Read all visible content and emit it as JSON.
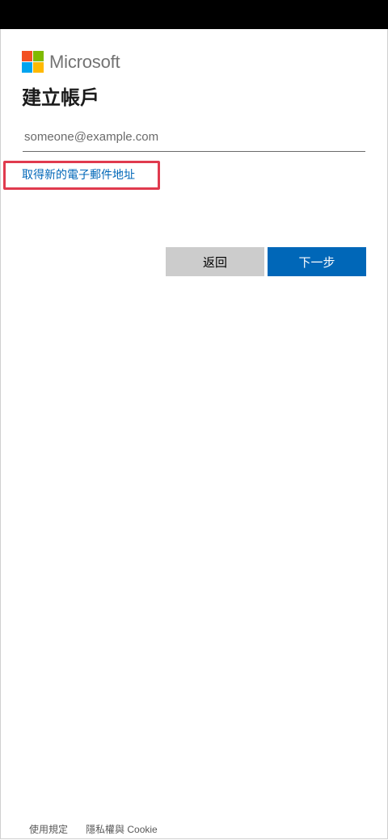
{
  "brand": {
    "name": "Microsoft",
    "logo_colors": [
      "#f25022",
      "#7fba00",
      "#00a4ef",
      "#ffb900"
    ]
  },
  "page": {
    "title": "建立帳戶"
  },
  "form": {
    "email_placeholder": "someone@example.com",
    "email_value": "",
    "new_email_link": "取得新的電子郵件地址"
  },
  "buttons": {
    "back_label": "返回",
    "next_label": "下一步"
  },
  "footer": {
    "terms_label": "使用規定",
    "privacy_label": "隱私權與 Cookie"
  },
  "colors": {
    "accent": "#0067b8",
    "secondary_button": "#cccccc",
    "highlight": "#e03a4e"
  }
}
